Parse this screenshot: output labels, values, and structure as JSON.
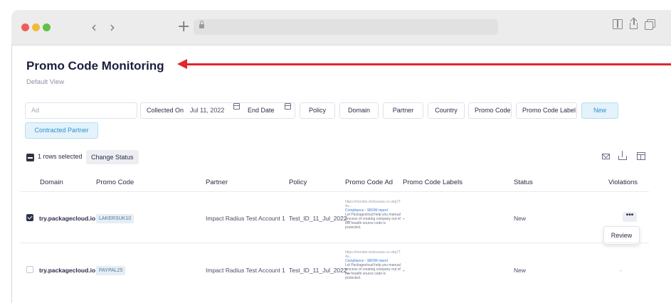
{
  "browser": {
    "back_glyph": "‹",
    "forward_glyph": "›",
    "new_tab_glyph": "+",
    "url": ""
  },
  "page": {
    "title": "Promo Code Monitoring",
    "subtitle": "Default View"
  },
  "annotation": {
    "arrow_color": "#e0262c"
  },
  "filters": {
    "search_placeholder": "Ad",
    "collected_on_label": "Collected On",
    "collected_on_value": "Jul 11, 2022",
    "end_date_label": "End Date",
    "chips": {
      "policy": "Policy",
      "domain": "Domain",
      "partner": "Partner",
      "country": "Country",
      "promo_code": "Promo Code",
      "promo_code_label": "Promo Code Label",
      "new": "New",
      "contracted_partner": "Contracted Partner"
    }
  },
  "toolbar": {
    "rows_selected": "1 rows selected",
    "change_status": "Change Status"
  },
  "table": {
    "headers": {
      "domain": "Domain",
      "promo_code": "Promo Code",
      "partner": "Partner",
      "policy": "Policy",
      "promo_code_ad": "Promo Code Ad",
      "promo_code_labels": "Promo Code Labels",
      "status": "Status",
      "violations": "Violations"
    },
    "rows": [
      {
        "checked": true,
        "domain": "try.packagecloud.io",
        "promo_code": "LAKERSUK10",
        "partner": "Impact Radius Test Account 1",
        "policy": "Test_ID_11_Jul_2022_",
        "ad_url": "https://monitor.clickcease.co ubq7T4u...",
        "ad_title": "Compliance - SBOM report",
        "ad_desc": "Let Packagecloud help you manual process of creating company out of the headlir source code is protected.",
        "labels": "-",
        "status": "New",
        "violations": "",
        "more": "•••",
        "review": "Review"
      },
      {
        "checked": false,
        "domain": "try.packagecloud.io",
        "promo_code": "PAYPAL25",
        "partner": "Impact Radius Test Account 1",
        "policy": "Test_ID_11_Jul_2022_",
        "ad_url": "https://monitor.clickcease.co ubq7T4u...",
        "ad_title": "Compliance - SBOM report",
        "ad_desc": "Let Packagecloud help you manual process of creating company out of the headlir source code is protected.",
        "labels": "-",
        "status": "New",
        "violations": "-"
      }
    ]
  },
  "colors": {
    "accent_chip_bg": "#e3f2fb",
    "accent_chip_text": "#2f8fc7",
    "title_text": "#1b1f3b"
  }
}
